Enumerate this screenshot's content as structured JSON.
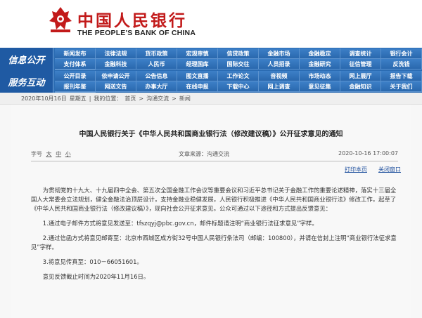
{
  "header": {
    "logo_cn": "中国人民银行",
    "logo_en": "THE PEOPLE'S BANK OF CHINA"
  },
  "nav": {
    "row1": {
      "title": "信息公开",
      "items": [
        "新闻发布",
        "法律法规",
        "货币政策",
        "宏观审慎",
        "信贷政策",
        "金融市场",
        "金融稳定",
        "调查统计",
        "银行会计",
        "支付体系",
        "金融科技",
        "人民币",
        "经理国库",
        "国际交往",
        "人员招录",
        "金融研究",
        "征信管理",
        "反洗钱",
        "党建工作"
      ]
    },
    "row2": {
      "title": "服务互动",
      "items": [
        "公开目录",
        "依申请公开",
        "公告信息",
        "图文直播",
        "工作论文",
        "音视频",
        "市场动态",
        "网上展厅",
        "报告下载",
        "报刊年鉴",
        "网送文告",
        "办事大厅",
        "在线申报",
        "下载中心",
        "网上调查",
        "意见征集",
        "金融知识",
        "关于我们",
        ""
      ]
    }
  },
  "breadcrumb": {
    "date": "2020年10月16日",
    "weekday": "星期五",
    "location_label": "我的位置：",
    "home": "首页",
    "sep": ">",
    "section": "沟通交流",
    "current": "新闻"
  },
  "article": {
    "title": "中国人民银行关于《中华人民共和国商业银行法（修改建议稿）》公开征求意见的通知",
    "fontsize_label": "字号",
    "fontsize_large": "大",
    "fontsize_medium": "中",
    "fontsize_small": "小",
    "source": "文章来源：沟通交流",
    "date": "2020-10-16 17:00:07",
    "print_label": "打印本页",
    "close_label": "关闭窗口",
    "paragraphs": [
      "为贯彻党的十九大、十九届四中全会、第五次全国金融工作会议等重要会议和习近平总书记关于金融工作的重要论述精神，落实十三届全国人大常委会立法规划，健全金融法治顶层设计，支持金融业稳健发展，人民银行积极推进《中华人民共和国商业银行法》修改工作，起草了《中华人民共和国商业银行法（修改建议稿）》，现向社会公开征求意见。公众可通过以下途径和方式提出反馈意见：",
      "1.通过电子邮件方式将意见发送至：tfszqyj@pbc.gov.cn，邮件标题请注明“商业银行法征求意见”字样。",
      "2.通过信函方式将意见邮寄至：北京市西城区成方街32号中国人民银行条法司（邮编：100800），并请在信封上注明“商业银行法征求意见”字样。",
      "3.将意见传真至：010－66051601。",
      "意见反馈截止时间为2020年11月16日。"
    ]
  },
  "colors": {
    "brand_red": "#c21a1a",
    "nav_blue": "#2b6cb3",
    "link_blue": "#1b4d9c"
  }
}
